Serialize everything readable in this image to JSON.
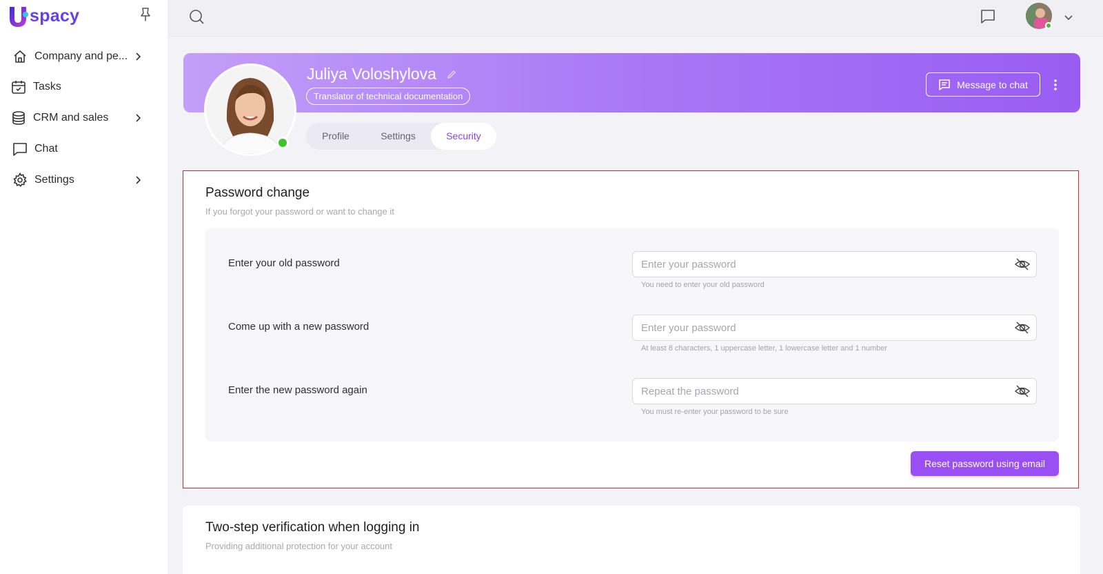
{
  "app": {
    "brand": "spacy",
    "brand_color": "#6a3ee8",
    "accent": "#9a4ff5"
  },
  "sidebar": {
    "items": [
      {
        "label": "Company and pe...",
        "icon": "home-icon",
        "has_submenu": true
      },
      {
        "label": "Tasks",
        "icon": "calendar-check-icon",
        "has_submenu": false
      },
      {
        "label": "CRM and sales",
        "icon": "database-icon",
        "has_submenu": true
      },
      {
        "label": "Chat",
        "icon": "chat-icon",
        "has_submenu": false
      },
      {
        "label": "Settings",
        "icon": "gear-icon",
        "has_submenu": true
      }
    ]
  },
  "profile": {
    "name": "Juliya Voloshylova",
    "role": "Translator of technical documentation",
    "message_button": "Message to chat",
    "tabs": [
      {
        "label": "Profile",
        "active": false
      },
      {
        "label": "Settings",
        "active": false
      },
      {
        "label": "Security",
        "active": true
      }
    ]
  },
  "password_change": {
    "title": "Password change",
    "subtitle": "If you forgot your password or want to change it",
    "fields": [
      {
        "label": "Enter your old password",
        "placeholder": "Enter your password",
        "value": "",
        "hint": "You need to enter your old password"
      },
      {
        "label": "Come up with a new password",
        "placeholder": "Enter your password",
        "value": "",
        "hint": "At least 8 characters, 1 uppercase letter, 1 lowercase letter and 1 number"
      },
      {
        "label": "Enter the new password again",
        "placeholder": "Repeat the password",
        "value": "",
        "hint": "You must re-enter your password to be sure"
      }
    ],
    "reset_button": "Reset password using email"
  },
  "two_step": {
    "title": "Two-step verification when logging in",
    "subtitle": "Providing additional protection for your account"
  }
}
